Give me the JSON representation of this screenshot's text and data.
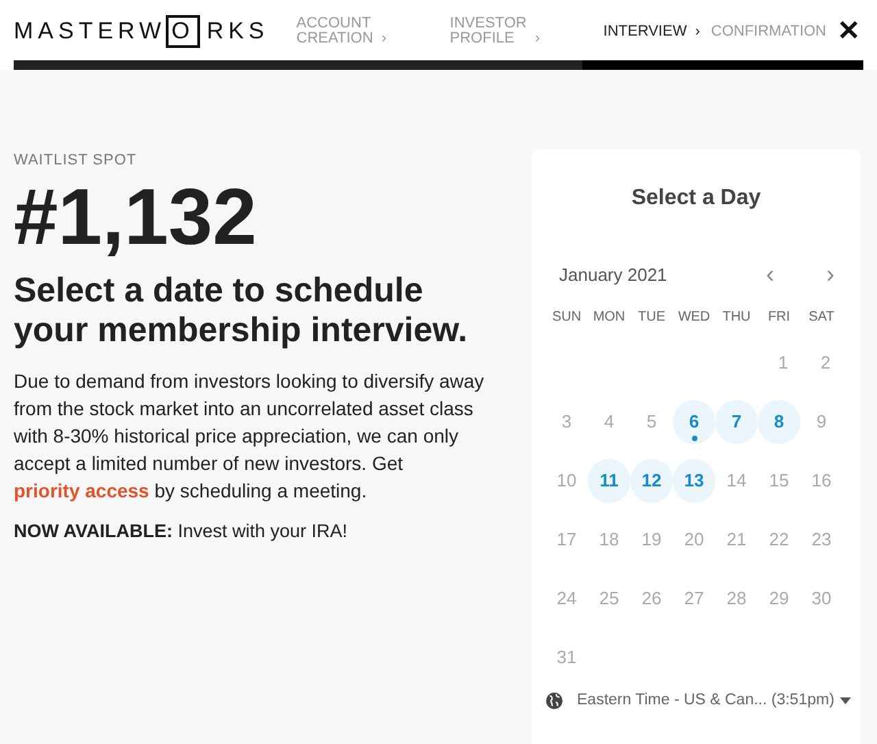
{
  "header": {
    "logo": {
      "before": "MASTERW",
      "boxed": "O",
      "after": "RKS"
    },
    "steps": [
      {
        "lines": [
          "ACCOUNT",
          "CREATION"
        ],
        "chevron": "›",
        "selected": false
      },
      {
        "lines": [
          "INVESTOR",
          "PROFILE"
        ],
        "chevron": "›",
        "selected": false
      },
      {
        "lines": [
          "INTERVIEW"
        ],
        "chevron": "›",
        "selected": true
      },
      {
        "lines": [
          "CONFIRMATION"
        ],
        "selected": false
      }
    ],
    "close": "✕",
    "progress": {
      "level": 0.67
    }
  },
  "intro": {
    "eyebrow": "WAITLIST SPOT",
    "spot": "#1,132",
    "heading": "Select a date to schedule your membership interview.",
    "body_before": "Due to demand from investors looking to diversify away from the stock market into an uncorrelated asset class with 8-30% historical price appreciation, we can only accept a limited number of new investors. Get ",
    "link": "priority access",
    "body_after": " by scheduling a meeting.",
    "notice": "**NOW AVAILABLE:** Invest with your IRA!"
  },
  "calendar": {
    "title": "Select a Day",
    "month": "January 2021",
    "prev": "‹",
    "next": "›",
    "weekdays": [
      "SUN",
      "MON",
      "TUE",
      "WED",
      "THU",
      "FRI",
      "SAT"
    ],
    "weeks": [
      [
        {
          "label": "1",
          "available": false,
          "today": false
        },
        {
          "label": "2",
          "available": false,
          "today": false
        }
      ],
      [
        {
          "label": "3",
          "available": false,
          "today": false
        },
        {
          "label": "4",
          "available": false,
          "today": false
        },
        {
          "label": "5",
          "available": false,
          "today": false
        },
        {
          "label": "6",
          "available": true,
          "today": true
        },
        {
          "label": "7",
          "available": true,
          "today": false
        },
        {
          "label": "8",
          "available": true,
          "today": false
        },
        {
          "label": "9",
          "available": false,
          "today": false
        }
      ],
      [
        {
          "label": "10",
          "available": false,
          "today": false
        },
        {
          "label": "11",
          "available": true,
          "today": false
        },
        {
          "label": "12",
          "available": true,
          "today": false
        },
        {
          "label": "13",
          "available": true,
          "today": false
        },
        {
          "label": "14",
          "available": false,
          "today": false
        },
        {
          "label": "15",
          "available": false,
          "today": false
        },
        {
          "label": "16",
          "available": false,
          "today": false
        }
      ],
      [
        {
          "label": "17",
          "available": false,
          "today": false
        },
        {
          "label": "18",
          "available": false,
          "today": false
        },
        {
          "label": "19",
          "available": false,
          "today": false
        },
        {
          "label": "20",
          "available": false,
          "today": false
        },
        {
          "label": "21",
          "available": false,
          "today": false
        },
        {
          "label": "22",
          "available": false,
          "today": false
        },
        {
          "label": "23",
          "available": false,
          "today": false
        }
      ],
      [
        {
          "label": "24",
          "available": false,
          "today": false
        },
        {
          "label": "25",
          "available": false,
          "today": false
        },
        {
          "label": "26",
          "available": false,
          "today": false
        },
        {
          "label": "27",
          "available": false,
          "today": false
        },
        {
          "label": "28",
          "available": false,
          "today": false
        },
        {
          "label": "29",
          "available": false,
          "today": false
        },
        {
          "label": "30",
          "available": false,
          "today": false
        }
      ],
      [
        {
          "label": "31",
          "available": false,
          "today": false
        }
      ]
    ],
    "timezone": "Eastern Time - US & Can... (3:51pm)"
  }
}
